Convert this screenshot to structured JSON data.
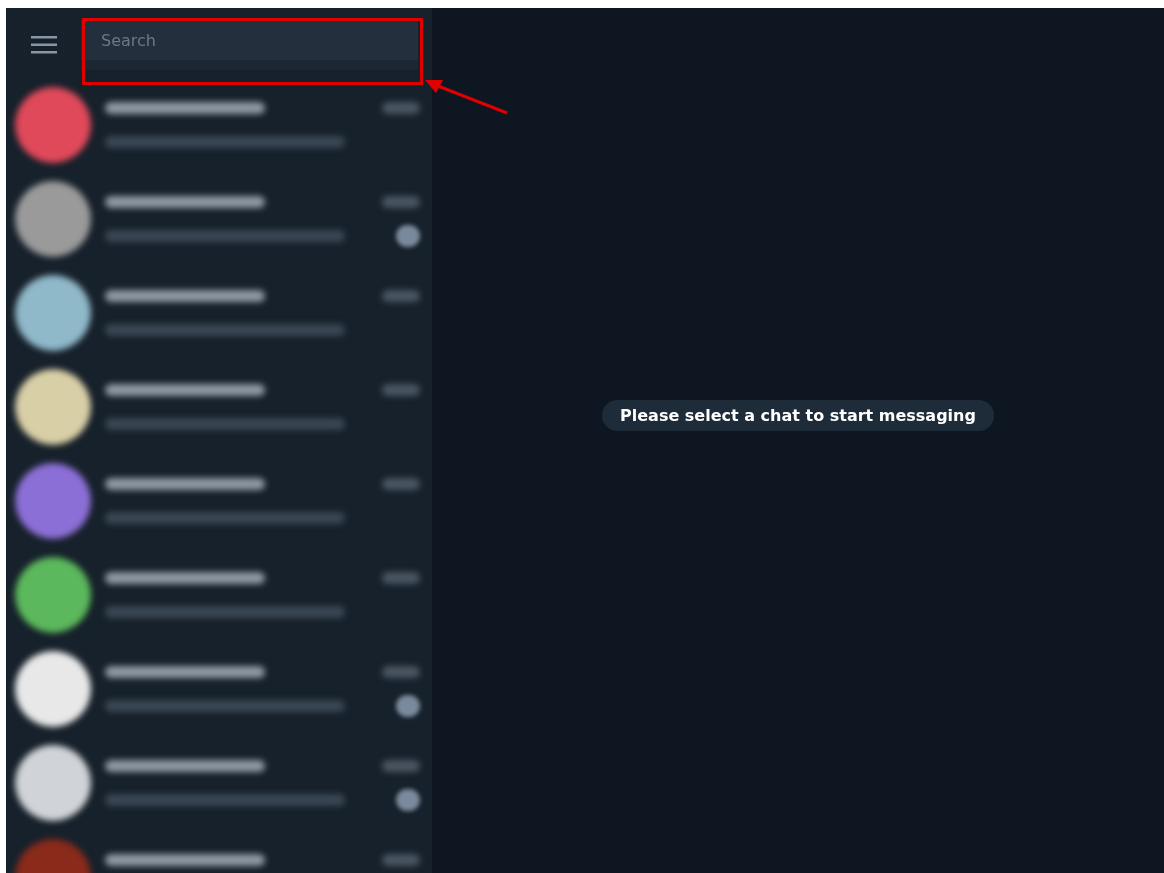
{
  "search": {
    "placeholder": "Search"
  },
  "chats": [
    {
      "color": "#e0495a",
      "badge": false
    },
    {
      "color": "#9a9a9a",
      "badge": true
    },
    {
      "color": "#8fb8c9",
      "badge": false
    },
    {
      "color": "#d8cfa6",
      "badge": false
    },
    {
      "color": "#8c6fd6",
      "badge": false
    },
    {
      "color": "#5cb85c",
      "badge": false
    },
    {
      "color": "#e8e8e8",
      "badge": true
    },
    {
      "color": "#d0d4d8",
      "badge": true
    },
    {
      "color": "#8a2a1a",
      "badge": false
    }
  ],
  "empty_state": "Please select a chat to start messaging"
}
